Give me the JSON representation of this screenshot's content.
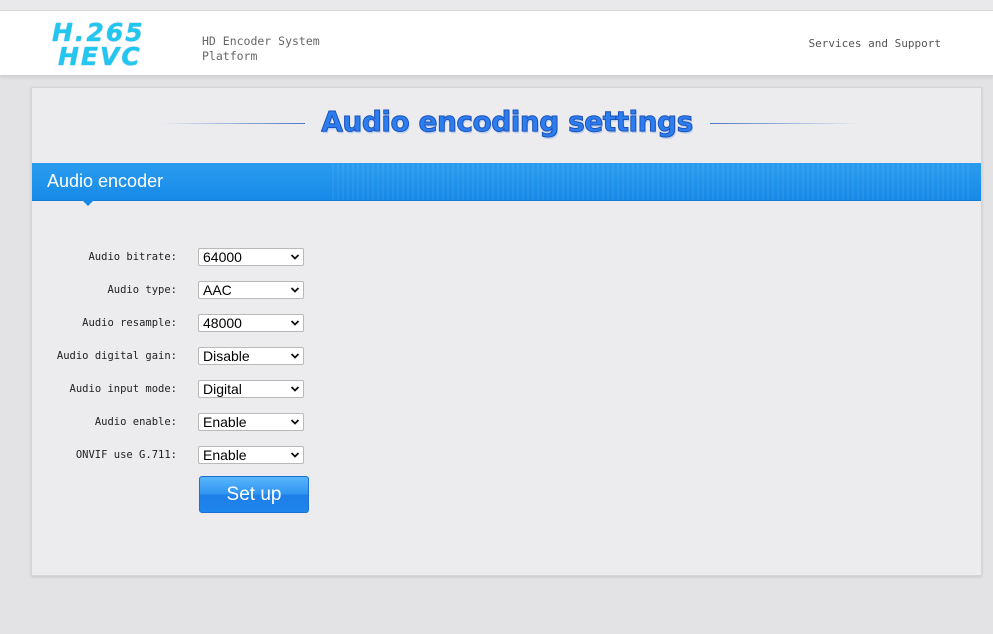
{
  "header": {
    "logo_line1": "H.265",
    "logo_line2": "HEVC",
    "subtitle": "HD Encoder System Platform",
    "support_link": "Services and Support"
  },
  "page": {
    "title": "Audio encoding settings"
  },
  "section": {
    "title": "Audio encoder"
  },
  "form": {
    "fields": [
      {
        "label": "Audio bitrate:",
        "value": "64000"
      },
      {
        "label": "Audio type:",
        "value": "AAC"
      },
      {
        "label": "Audio resample:",
        "value": "48000"
      },
      {
        "label": "Audio digital gain:",
        "value": "Disable"
      },
      {
        "label": "Audio input mode:",
        "value": "Digital"
      },
      {
        "label": "Audio enable:",
        "value": "Enable"
      },
      {
        "label": "ONVIF use G.711:",
        "value": "Enable"
      }
    ],
    "submit_label": "Set up"
  },
  "colors": {
    "accent": "#178ae8",
    "logo": "#22c7ef",
    "title": "#2c7ef0"
  },
  "icons": {
    "select_arrow": "chevron-down-icon"
  }
}
